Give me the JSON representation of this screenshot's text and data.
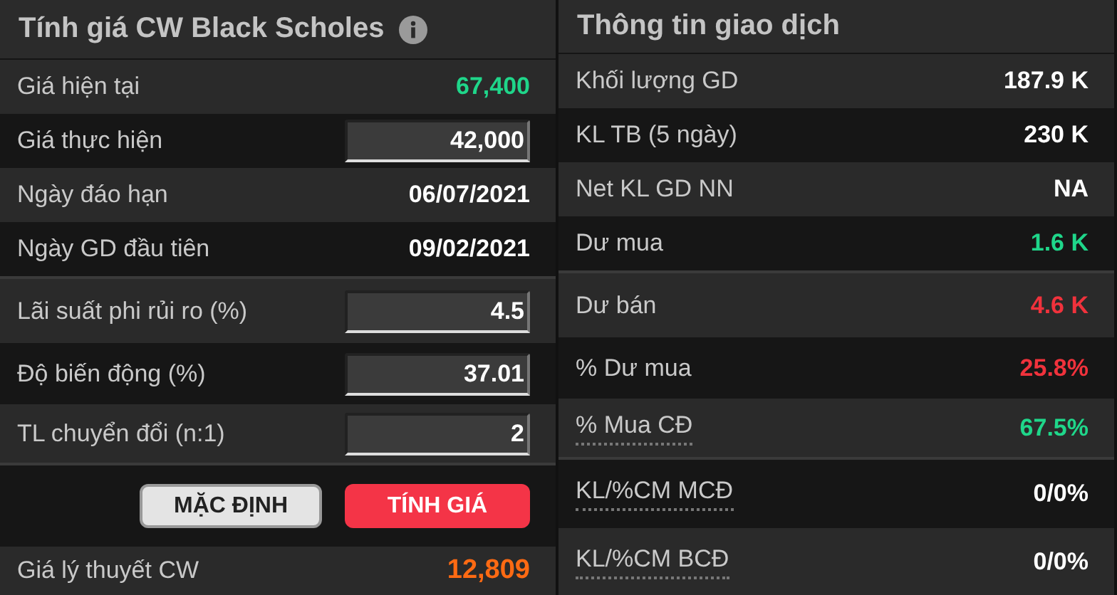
{
  "calculator": {
    "title": "Tính giá CW Black Scholes",
    "groups": [
      {
        "rows": [
          {
            "label": "Giá hiện tại",
            "kind": "value",
            "value": "67,400",
            "color": "#1fd68a"
          },
          {
            "label": "Giá thực hiện",
            "kind": "input",
            "value": "42,000"
          },
          {
            "label": "Ngày đáo hạn",
            "kind": "value",
            "value": "06/07/2021",
            "color": "#ffffff"
          },
          {
            "label": "Ngày GD đầu tiên",
            "kind": "value",
            "value": "09/02/2021",
            "color": "#ffffff"
          }
        ]
      },
      {
        "rows": [
          {
            "label": "Lãi suất phi rủi ro (%)",
            "kind": "input",
            "value": "4.5"
          },
          {
            "label": "Độ biến động (%)",
            "kind": "input",
            "value": "37.01"
          },
          {
            "label": "TL chuyển đổi (n:1)",
            "kind": "input",
            "value": "2"
          }
        ]
      }
    ],
    "buttons": [
      {
        "label": "MẶC ĐỊNH",
        "kind": "secondary"
      },
      {
        "label": "TÍNH GIÁ",
        "kind": "primary"
      }
    ],
    "result": {
      "label": "Giá lý thuyết CW",
      "value": "12,809"
    }
  },
  "trading_info": {
    "title": "Thông tin giao dịch",
    "groups": [
      {
        "rows": [
          {
            "label": "Khối lượng GD",
            "value": "187.9 K",
            "color": "#ffffff",
            "underlined": false
          },
          {
            "label": "KL TB (5 ngày)",
            "value": "230 K",
            "color": "#ffffff",
            "underlined": false
          },
          {
            "label": "Net KL GD NN",
            "value": "NA",
            "color": "#ffffff",
            "underlined": false
          },
          {
            "label": "Dư mua",
            "value": "1.6 K",
            "color": "#1fd68a",
            "underlined": false
          }
        ]
      },
      {
        "rows": [
          {
            "label": "Dư bán",
            "value": "4.6 K",
            "color": "#f0323c",
            "underlined": false
          },
          {
            "label": "% Dư mua",
            "value": "25.8%",
            "color": "#f0323c",
            "underlined": false
          },
          {
            "label": "% Mua CĐ",
            "value": "67.5%",
            "color": "#1fd68a",
            "underlined": true
          }
        ]
      },
      {
        "rows": [
          {
            "label": "KL/%CM MCĐ",
            "value": "0/0%",
            "color": "#ffffff",
            "underlined": true
          },
          {
            "label": "KL/%CM BCĐ",
            "value": "0/0%",
            "color": "#ffffff",
            "underlined": true
          }
        ]
      }
    ]
  }
}
